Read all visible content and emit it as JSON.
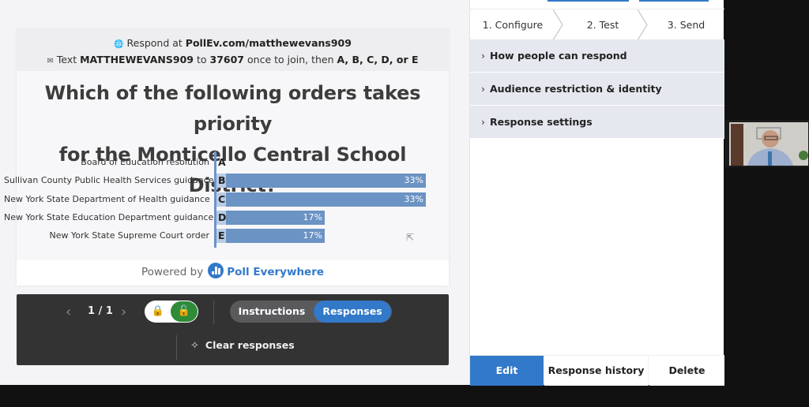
{
  "slide": {
    "respond_prefix": "Respond at",
    "respond_url": "PollEv.com/matthewevans909",
    "text_prefix": "Text",
    "text_code": "MATTHEWEVANS909",
    "text_to": "to",
    "text_number": "37607",
    "text_mid": "once to join, then",
    "text_options": "A, B, C, D, or E",
    "question_line1": "Which of the following orders takes priority",
    "question_line2": "for the Monticello Central School District?",
    "powered_by": "Powered by",
    "brand": "Poll Everywhere",
    "accent": "#3379c9",
    "bar_color": "#6b93c3"
  },
  "chart_data": {
    "type": "bar",
    "orientation": "horizontal",
    "categories": [
      "Board of Education resolution",
      "Sullivan County Public Health Services guidance",
      "New York State Department of Health guidance",
      "New York State Education Department guidance",
      "New York State Supreme Court order"
    ],
    "letters": [
      "A",
      "B",
      "C",
      "D",
      "E"
    ],
    "values": [
      0,
      33,
      33,
      17,
      17
    ],
    "labels": [
      "",
      "33%",
      "33%",
      "17%",
      "17%"
    ],
    "unit": "%",
    "xlim": [
      0,
      50
    ]
  },
  "controls": {
    "pager": "1 / 1",
    "instructions_label": "Instructions",
    "responses_label": "Responses",
    "clear_label": "Clear responses"
  },
  "sidebar": {
    "steps": [
      "1. Configure",
      "2. Test",
      "3. Send"
    ],
    "sections": [
      "How people can respond",
      "Audience restriction & identity",
      "Response settings"
    ],
    "footer": {
      "edit": "Edit",
      "history": "Response history",
      "delete": "Delete"
    }
  }
}
